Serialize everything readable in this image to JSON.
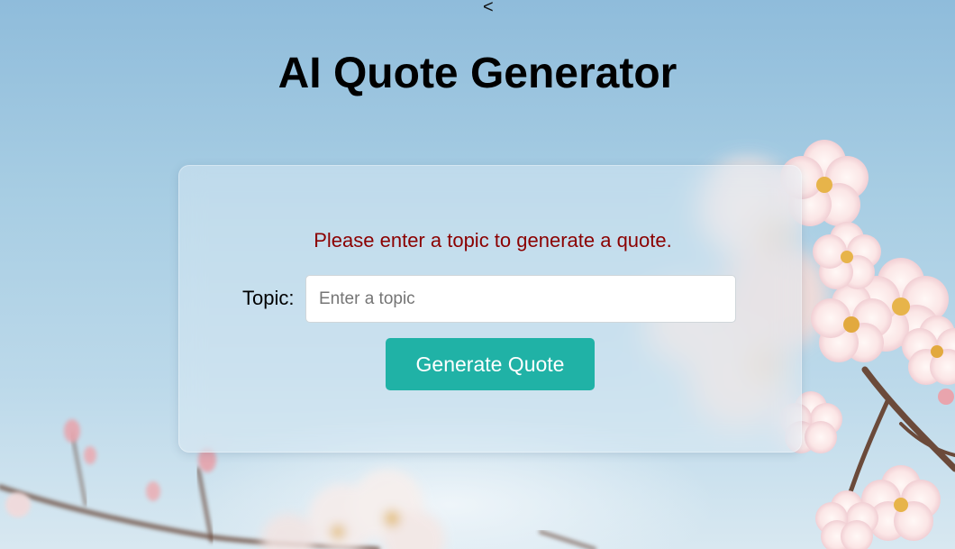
{
  "nav": {
    "back_icon": "chevron-left-icon",
    "back_glyph": "<"
  },
  "page": {
    "title": "AI Quote Generator"
  },
  "form": {
    "status_message": "Please enter a topic to generate a quote.",
    "topic_label": "Topic:",
    "topic_value": "",
    "topic_placeholder": "Enter a topic",
    "generate_label": "Generate Quote"
  },
  "theme": {
    "title_color": "#000000",
    "status_color": "#8b0000",
    "button_color": "#20b2a6",
    "button_text_color": "#ffffff",
    "background_image": "cherry-blossom-sky"
  }
}
